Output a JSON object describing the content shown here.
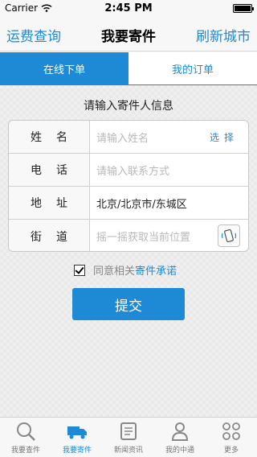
{
  "status_bar": {
    "carrier": "Carrier",
    "time": "2:45 PM"
  },
  "nav": {
    "left": "运费查询",
    "title": "我要寄件",
    "right": "刷新城市"
  },
  "tabs": [
    {
      "label": "在线下单",
      "active": true
    },
    {
      "label": "我的订单",
      "active": false
    }
  ],
  "form": {
    "title": "请输入寄件人信息",
    "rows": [
      {
        "label": "姓名",
        "placeholder": "请输入姓名",
        "value": "",
        "action": "选择"
      },
      {
        "label": "电话",
        "placeholder": "请输入联系方式",
        "value": ""
      },
      {
        "label": "地址",
        "placeholder": "",
        "value": "北京/北京市/东城区"
      },
      {
        "label": "街道",
        "placeholder": "摇一摇获取当前位置",
        "value": ""
      }
    ],
    "agree_text": "同意相关",
    "agree_link": "寄件承诺",
    "agree_checked": true,
    "submit": "提交"
  },
  "tabbar": [
    {
      "label": "我要查件",
      "icon": "search-icon",
      "active": false
    },
    {
      "label": "我要寄件",
      "icon": "truck-icon",
      "active": true
    },
    {
      "label": "新闻资讯",
      "icon": "news-icon",
      "active": false
    },
    {
      "label": "我的中通",
      "icon": "user-icon",
      "active": false
    },
    {
      "label": "更多",
      "icon": "more-icon",
      "active": false
    }
  ],
  "colors": {
    "accent": "#1e8ad6",
    "tab_inactive_text": "#777777"
  }
}
